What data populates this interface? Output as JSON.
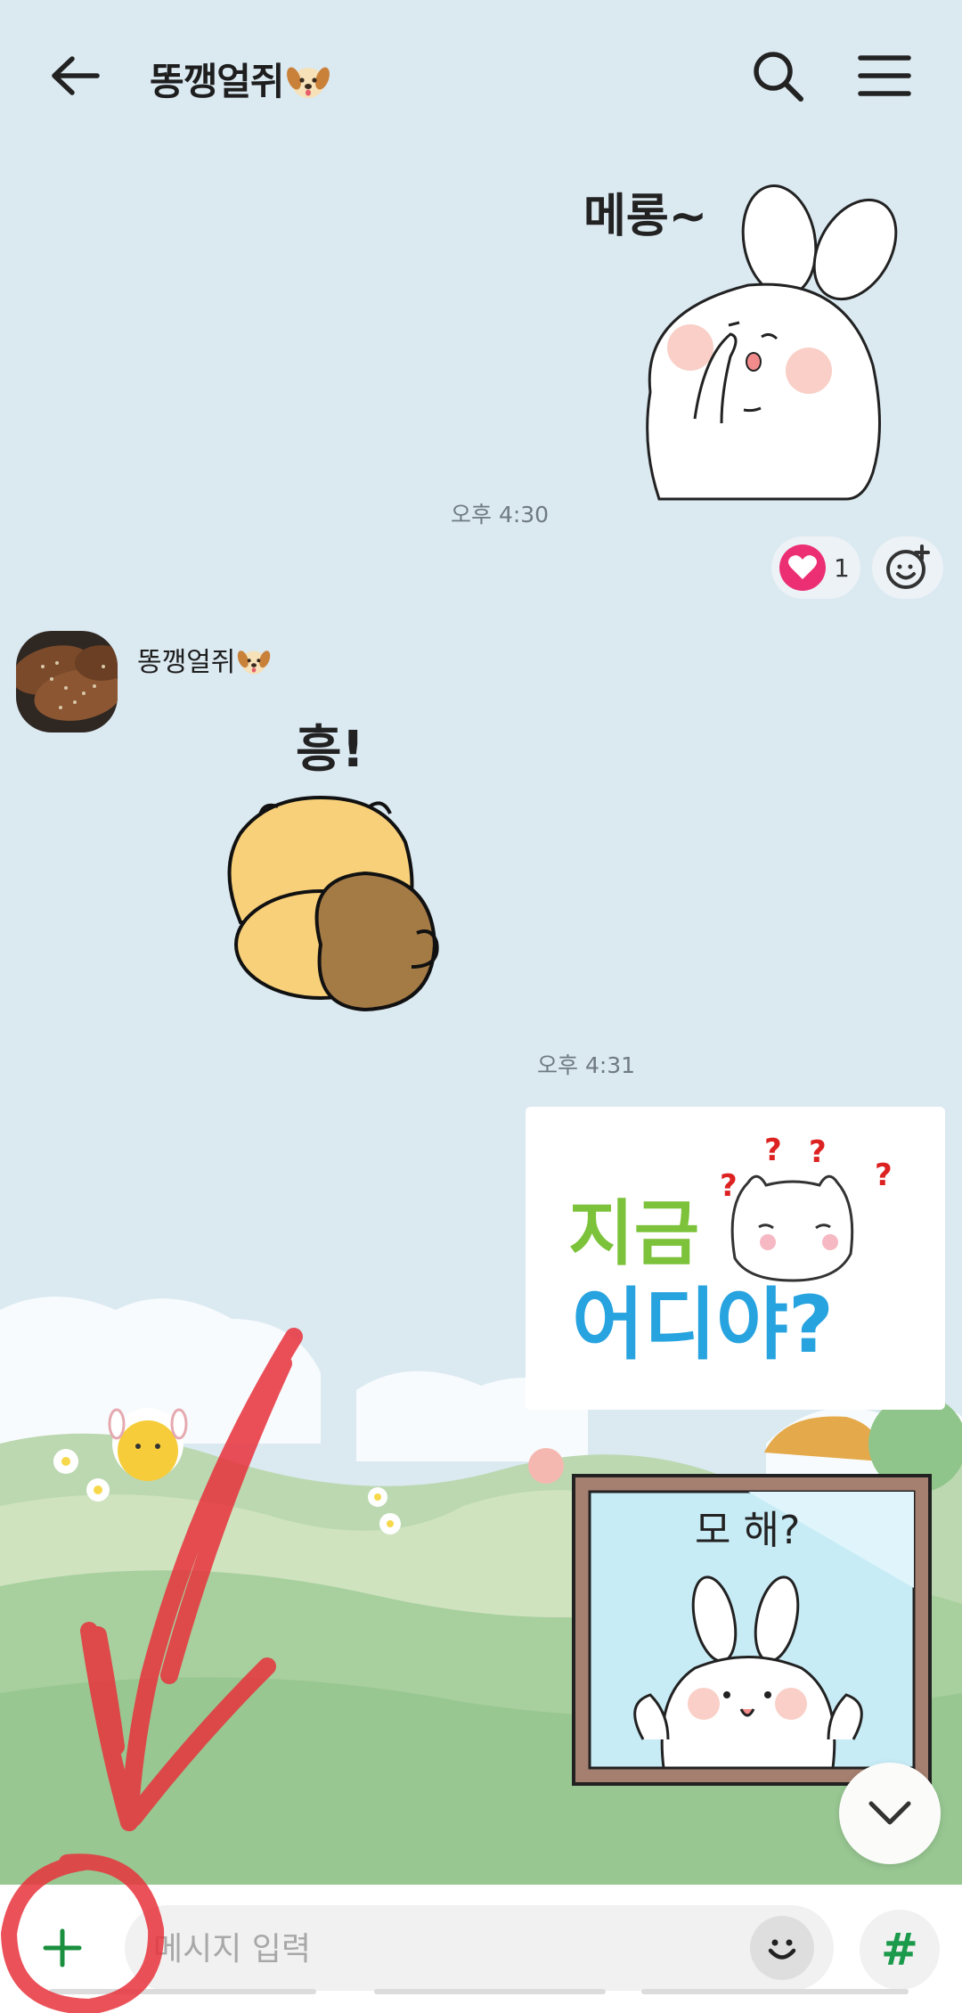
{
  "header": {
    "back_icon": "arrow-left-icon",
    "title": "똥깽얼쥐",
    "title_emoji": "dog-face-emoji",
    "search_icon": "search-icon",
    "menu_icon": "hamburger-menu-icon"
  },
  "messages": {
    "sticker1_text": "메롱~",
    "time1": "오후 4:30",
    "reaction_icon": "heart-icon",
    "reaction_count": "1",
    "sender_name": "똥깽얼쥐",
    "sticker2_text": "흥!",
    "time2": "오후 4:31",
    "image_line1": "지금",
    "image_line2": "어디야?",
    "sticker3_text": "모 해?"
  },
  "input": {
    "placeholder": "메시지 입력",
    "plus_icon": "plus-icon",
    "emoji_icon": "smiley-icon",
    "hash_label": "#"
  },
  "colors": {
    "chat_bg": "#dbe9f1",
    "accent_green": "#1a9a4a",
    "annotation_red": "#e8323c",
    "heart_pink": "#ec2f73"
  }
}
